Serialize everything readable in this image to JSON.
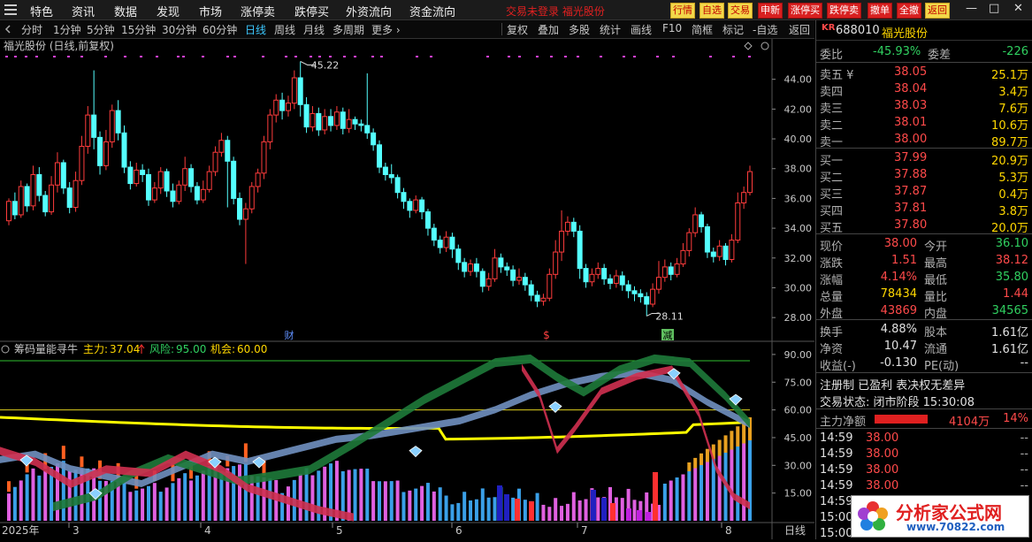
{
  "menu": [
    "特色",
    "资讯",
    "数据",
    "发现",
    "市场",
    "涨停卖",
    "跌停买",
    "外资流向",
    "资金流向"
  ],
  "notice": "交易未登录  福光股份",
  "quick_buttons": [
    {
      "label": "行情",
      "style": "yellow"
    },
    {
      "label": "自选",
      "style": "yellow"
    },
    {
      "label": "交易",
      "style": "yellow"
    },
    {
      "label": "申新",
      "style": "red"
    },
    {
      "label": "涨停买",
      "style": "red"
    },
    {
      "label": "跌停卖",
      "style": "red"
    },
    {
      "label": "撤单",
      "style": "red"
    },
    {
      "label": "全撤",
      "style": "red"
    },
    {
      "label": "返回",
      "style": "yellow"
    }
  ],
  "window_controls": [
    "—",
    "□",
    "✕"
  ],
  "periods": [
    "分时",
    "1分钟",
    "5分钟",
    "15分钟",
    "30分钟",
    "60分钟",
    "日线",
    "周线",
    "月线",
    "多周期",
    "更多 ›"
  ],
  "active_period": "日线",
  "tools": [
    "复权",
    "叠加",
    "多股",
    "统计",
    "画线",
    "F10",
    "简框",
    "标记",
    "-自选",
    "返回"
  ],
  "chart_data": {
    "type": "candlestick",
    "title": "福光股份 (日线,前复权)",
    "ylim": [
      27,
      46
    ],
    "yticks": [
      "44.00",
      "42.00",
      "40.00",
      "38.00",
      "36.00",
      "34.00",
      "32.00",
      "30.00",
      "28.00"
    ],
    "high_label": "45.22",
    "low_label": "28.11",
    "candles": [
      [
        34.5,
        35.8,
        34.2,
        36.0
      ],
      [
        35.8,
        34.9,
        34.6,
        36.4
      ],
      [
        34.9,
        36.8,
        34.7,
        37.2
      ],
      [
        36.8,
        35.5,
        35.1,
        37.0
      ],
      [
        35.5,
        37.6,
        35.2,
        38.2
      ],
      [
        37.6,
        36.2,
        35.8,
        38.1
      ],
      [
        36.2,
        35.1,
        34.8,
        36.5
      ],
      [
        35.1,
        36.9,
        34.9,
        37.5
      ],
      [
        36.9,
        38.4,
        36.4,
        39.1
      ],
      [
        38.4,
        36.7,
        36.3,
        38.6
      ],
      [
        36.7,
        35.4,
        35.0,
        37.1
      ],
      [
        35.4,
        37.2,
        35.1,
        37.8
      ],
      [
        37.2,
        39.5,
        36.9,
        40.2
      ],
      [
        39.5,
        41.6,
        39.0,
        42.2
      ],
      [
        41.6,
        40.1,
        39.3,
        44.6
      ],
      [
        40.1,
        38.2,
        37.6,
        40.5
      ],
      [
        38.2,
        39.8,
        37.9,
        40.6
      ],
      [
        39.8,
        41.9,
        39.4,
        42.3
      ],
      [
        41.9,
        40.4,
        39.9,
        42.6
      ],
      [
        40.4,
        38.1,
        37.7,
        40.9
      ],
      [
        38.1,
        37.0,
        36.6,
        38.5
      ],
      [
        37.0,
        37.9,
        36.8,
        38.4
      ],
      [
        37.9,
        37.6,
        37.1,
        38.3
      ],
      [
        37.6,
        35.9,
        35.5,
        38.0
      ],
      [
        35.9,
        36.7,
        35.7,
        37.1
      ],
      [
        36.7,
        37.8,
        36.3,
        38.1
      ],
      [
        37.8,
        36.5,
        36.1,
        38.0
      ],
      [
        36.5,
        35.8,
        35.4,
        37.0
      ],
      [
        35.8,
        36.9,
        35.6,
        37.2
      ],
      [
        36.9,
        38.0,
        36.5,
        38.8
      ],
      [
        38.0,
        36.8,
        36.4,
        38.3
      ],
      [
        36.8,
        35.9,
        35.6,
        37.1
      ],
      [
        35.9,
        36.6,
        35.7,
        37.2
      ],
      [
        36.6,
        37.8,
        36.4,
        38.2
      ],
      [
        37.8,
        39.1,
        37.5,
        39.5
      ],
      [
        39.1,
        39.9,
        38.8,
        40.4
      ],
      [
        39.9,
        38.5,
        35.4,
        40.2
      ],
      [
        38.5,
        36.0,
        35.6,
        38.8
      ],
      [
        36.0,
        34.6,
        34.2,
        36.4
      ],
      [
        34.6,
        35.3,
        31.6,
        35.7
      ],
      [
        35.3,
        36.8,
        35.0,
        37.1
      ],
      [
        36.8,
        37.7,
        36.4,
        38.0
      ],
      [
        37.7,
        39.8,
        37.3,
        40.2
      ],
      [
        39.8,
        41.6,
        39.3,
        42.0
      ],
      [
        41.6,
        42.6,
        41.1,
        43.0
      ],
      [
        42.6,
        41.9,
        41.3,
        43.1
      ],
      [
        41.9,
        42.4,
        41.5,
        42.9
      ],
      [
        42.4,
        44.1,
        42.0,
        44.6
      ],
      [
        44.1,
        42.3,
        41.5,
        45.2
      ],
      [
        42.3,
        40.8,
        40.4,
        42.8
      ],
      [
        40.8,
        41.7,
        40.5,
        42.2
      ],
      [
        41.7,
        40.6,
        40.2,
        42.1
      ],
      [
        40.6,
        41.5,
        40.3,
        42.0
      ],
      [
        41.5,
        40.9,
        40.5,
        42.0
      ],
      [
        40.9,
        41.8,
        40.6,
        42.2
      ],
      [
        41.8,
        40.7,
        40.3,
        42.1
      ],
      [
        40.7,
        41.3,
        40.4,
        42.0
      ],
      [
        41.3,
        41.0,
        40.6,
        41.5
      ],
      [
        41.0,
        40.9,
        40.5,
        41.3
      ],
      [
        40.9,
        40.4,
        40.0,
        44.4
      ],
      [
        40.4,
        39.6,
        39.2,
        40.7
      ],
      [
        39.6,
        38.1,
        37.7,
        39.9
      ],
      [
        38.1,
        37.6,
        37.2,
        38.4
      ],
      [
        37.6,
        37.4,
        37.0,
        38.3
      ],
      [
        37.4,
        36.4,
        36.0,
        37.6
      ],
      [
        36.4,
        35.8,
        35.3,
        36.7
      ],
      [
        35.8,
        35.2,
        34.7,
        36.0
      ],
      [
        35.2,
        35.9,
        35.0,
        36.2
      ],
      [
        35.9,
        35.1,
        34.6,
        36.1
      ],
      [
        35.1,
        34.0,
        33.5,
        35.3
      ],
      [
        34.0,
        33.2,
        32.8,
        34.3
      ],
      [
        33.2,
        32.7,
        32.3,
        33.5
      ],
      [
        32.7,
        33.4,
        32.4,
        33.8
      ],
      [
        33.4,
        32.6,
        32.0,
        33.7
      ],
      [
        32.6,
        31.7,
        31.2,
        32.9
      ],
      [
        31.7,
        31.1,
        30.7,
        32.0
      ],
      [
        31.1,
        31.6,
        30.8,
        31.9
      ],
      [
        31.6,
        31.1,
        30.7,
        32.0
      ],
      [
        31.1,
        30.1,
        29.7,
        31.3
      ],
      [
        30.1,
        30.6,
        29.8,
        31.0
      ],
      [
        30.6,
        32.0,
        30.4,
        32.6
      ],
      [
        32.0,
        31.4,
        31.0,
        32.3
      ],
      [
        31.4,
        31.2,
        30.8,
        31.7
      ],
      [
        31.2,
        30.5,
        30.1,
        31.5
      ],
      [
        30.5,
        30.7,
        30.2,
        31.3
      ],
      [
        30.7,
        30.2,
        29.8,
        31.0
      ],
      [
        30.2,
        29.5,
        29.1,
        30.5
      ],
      [
        29.5,
        29.1,
        28.7,
        29.8
      ],
      [
        29.1,
        29.3,
        28.8,
        29.6
      ],
      [
        29.3,
        30.9,
        29.1,
        31.3
      ],
      [
        30.9,
        32.4,
        30.6,
        33.2
      ],
      [
        32.4,
        33.8,
        31.8,
        35.2
      ],
      [
        33.8,
        34.4,
        33.5,
        34.8
      ],
      [
        34.4,
        33.8,
        33.4,
        34.7
      ],
      [
        33.8,
        31.3,
        30.6,
        34.2
      ],
      [
        31.3,
        30.4,
        30.0,
        31.6
      ],
      [
        30.4,
        30.9,
        30.1,
        31.3
      ],
      [
        30.9,
        31.3,
        30.6,
        31.7
      ],
      [
        31.3,
        30.6,
        30.2,
        31.6
      ],
      [
        30.6,
        30.3,
        29.9,
        30.9
      ],
      [
        30.3,
        30.8,
        30.0,
        31.2
      ],
      [
        30.8,
        30.2,
        29.8,
        31.1
      ],
      [
        30.2,
        29.8,
        29.3,
        30.5
      ],
      [
        29.8,
        29.6,
        29.1,
        30.1
      ],
      [
        29.6,
        29.4,
        29.0,
        29.9
      ],
      [
        29.4,
        28.9,
        28.1,
        29.7
      ],
      [
        28.9,
        29.9,
        28.7,
        30.3
      ],
      [
        29.9,
        30.7,
        29.6,
        31.8
      ],
      [
        30.7,
        31.4,
        30.4,
        31.9
      ],
      [
        31.4,
        30.9,
        30.5,
        31.7
      ],
      [
        30.9,
        31.6,
        30.7,
        32.0
      ],
      [
        31.6,
        32.5,
        31.4,
        33.0
      ],
      [
        32.5,
        33.7,
        32.1,
        34.0
      ],
      [
        33.7,
        34.9,
        33.4,
        35.4
      ],
      [
        34.9,
        34.1,
        33.7,
        35.1
      ],
      [
        34.1,
        32.4,
        32.0,
        34.3
      ],
      [
        32.4,
        32.1,
        31.7,
        32.7
      ],
      [
        32.1,
        32.8,
        31.8,
        33.2
      ],
      [
        32.8,
        31.9,
        31.5,
        33.0
      ],
      [
        31.9,
        33.2,
        31.7,
        33.6
      ],
      [
        33.2,
        35.7,
        33.0,
        36.4
      ],
      [
        35.7,
        36.4,
        35.3,
        36.8
      ],
      [
        36.4,
        37.8,
        36.2,
        38.2
      ]
    ],
    "xlabels": [
      "2025年",
      "3",
      "4",
      "5",
      "6",
      "7",
      "8",
      "日线"
    ],
    "event_markers": [
      "财",
      "$",
      "减"
    ]
  },
  "indicator": {
    "name": "筹码量能寻牛",
    "main_label": "主力:",
    "main_value": "37.04",
    "risk_label": "风险:",
    "risk_value": "95.00",
    "chance_label": "机会:",
    "chance_value": "60.00",
    "yticks": [
      "90.00",
      "75.00",
      "60.00",
      "45.00",
      "30.00",
      "15.00"
    ],
    "ylim": [
      0,
      100
    ]
  },
  "stock": {
    "badge": "KR",
    "code": "688010",
    "name": "福光股份",
    "ratio_label": "委比",
    "ratio_value": "-45.93%",
    "diff_label": "委差",
    "diff_value": "-226",
    "sells": [
      {
        "label": "卖五 ¥",
        "price": "38.05",
        "vol": "25.1万"
      },
      {
        "label": "卖四",
        "price": "38.04",
        "vol": "3.4万"
      },
      {
        "label": "卖三",
        "price": "38.03",
        "vol": "7.6万"
      },
      {
        "label": "卖二",
        "price": "38.01",
        "vol": "10.6万"
      },
      {
        "label": "卖一",
        "price": "38.00",
        "vol": "89.7万"
      }
    ],
    "buys": [
      {
        "label": "买一",
        "price": "37.99",
        "vol": "20.9万"
      },
      {
        "label": "买二",
        "price": "37.88",
        "vol": "5.3万"
      },
      {
        "label": "买三",
        "price": "37.87",
        "vol": "0.4万"
      },
      {
        "label": "买四",
        "price": "37.81",
        "vol": "3.8万"
      },
      {
        "label": "买五",
        "price": "37.80",
        "vol": "20.0万"
      }
    ],
    "stats": [
      {
        "l1": "现价",
        "v1": "38.00",
        "l2": "今开",
        "v2": "36.10",
        "c1": "red",
        "c2": "green"
      },
      {
        "l1": "涨跌",
        "v1": "1.51",
        "l2": "最高",
        "v2": "38.12",
        "c1": "red",
        "c2": "red"
      },
      {
        "l1": "涨幅",
        "v1": "4.14%",
        "l2": "最低",
        "v2": "35.80",
        "c1": "red",
        "c2": "green"
      },
      {
        "l1": "总量",
        "v1": "78434",
        "l2": "量比",
        "v2": "1.44",
        "c1": "yellow",
        "c2": "red"
      },
      {
        "l1": "外盘",
        "v1": "43869",
        "l2": "内盘",
        "v2": "34565",
        "c1": "red",
        "c2": "green"
      }
    ],
    "stats2": [
      {
        "l1": "换手",
        "v1": "4.88%",
        "l2": "股本",
        "v2": "1.61亿"
      },
      {
        "l1": "净资",
        "v1": "10.47",
        "l2": "流通",
        "v2": "1.61亿"
      },
      {
        "l1": "收益(-)",
        "v1": "-0.130",
        "l2": "PE(动)",
        "v2": "--"
      }
    ],
    "flags": "注册制 已盈利 表决权无差异",
    "status": "交易状态: 闭市阶段 15:30:08",
    "flow_label": "主力净额",
    "flow_value": "4104万",
    "flow_pct": "14%",
    "ticks": [
      {
        "time": "14:59",
        "price": "38.00",
        "vol": "--"
      },
      {
        "time": "14:59",
        "price": "38.00",
        "vol": "--"
      },
      {
        "time": "14:59",
        "price": "38.00",
        "vol": "--"
      },
      {
        "time": "14:59",
        "price": "38.00",
        "vol": "--"
      },
      {
        "time": "14:59",
        "price": "38.00",
        "vol": "--"
      },
      {
        "time": "15:00",
        "price": "38.00",
        "vol": "--"
      },
      {
        "time": "15:00",
        "price": "38.00",
        "vol": "--"
      }
    ]
  },
  "watermark": {
    "text": "分析家公式网",
    "url": "www.70822.com"
  },
  "colors": {
    "up": "#ff3c3c",
    "down": "#54ffff",
    "volume": "#e060e0",
    "bg": "#000000"
  }
}
